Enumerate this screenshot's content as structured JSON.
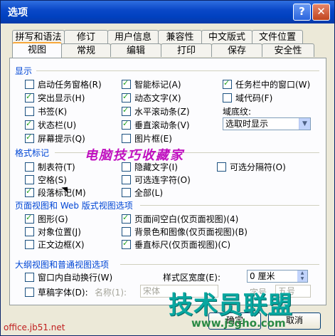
{
  "window": {
    "title": "选项",
    "help_glyph": "?",
    "close_glyph": "✕"
  },
  "tabs_back": [
    "拼写和语法",
    "修订",
    "用户信息",
    "兼容性",
    "中文版式",
    "文件位置"
  ],
  "tabs_front": [
    "视图",
    "常规",
    "编辑",
    "打印",
    "保存",
    "安全性"
  ],
  "display": {
    "title": "显示",
    "col1": [
      {
        "label": "启动任务窗格(R)",
        "checked": false
      },
      {
        "label": "突出显示(H)",
        "checked": true
      },
      {
        "label": "书签(K)",
        "checked": false
      },
      {
        "label": "状态栏(U)",
        "checked": true
      },
      {
        "label": "屏幕提示(Q)",
        "checked": true
      }
    ],
    "col2": [
      {
        "label": "智能标记(A)",
        "checked": true
      },
      {
        "label": "动态文字(X)",
        "checked": true
      },
      {
        "label": "水平滚动条(Z)",
        "checked": true
      },
      {
        "label": "垂直滚动条(V)",
        "checked": true
      },
      {
        "label": "图片框(E)",
        "checked": false
      }
    ],
    "col3": [
      {
        "label": "任务栏中的窗口(W)",
        "checked": true
      },
      {
        "label": "域代码(F)",
        "checked": false
      }
    ],
    "shading_label": "域底纹:",
    "shading_value": "选取时显示"
  },
  "format": {
    "title": "格式标记",
    "col1": [
      {
        "label": "制表符(T)",
        "checked": false
      },
      {
        "label": "空格(S)",
        "checked": false
      },
      {
        "label": "段落标记(M)",
        "checked": true
      }
    ],
    "col2": [
      {
        "label": "隐藏文字(I)",
        "checked": false
      },
      {
        "label": "可选连字符(O)",
        "checked": false
      },
      {
        "label": "全部(L)",
        "checked": false
      }
    ],
    "col3": [
      {
        "label": "可选分隔符(O)",
        "checked": false
      }
    ]
  },
  "page_web": {
    "title": "页面视图和 Web 版式视图选项",
    "col1": [
      {
        "label": "图形(G)",
        "checked": true
      },
      {
        "label": "对象位置(J)",
        "checked": false
      },
      {
        "label": "正文边框(X)",
        "checked": false
      }
    ],
    "col2": [
      {
        "label": "页面间空白(仅页面视图)(4)",
        "checked": true
      },
      {
        "label": "背景色和图像(仅页面视图)(B)",
        "checked": false
      },
      {
        "label": "垂直标尺(仅页面视图)(C)",
        "checked": true
      }
    ]
  },
  "outline": {
    "title": "大纲视图和普通视图选项",
    "wrap_label": "窗口内自动换行(W)",
    "draft_label": "草稿字体(D):",
    "name_label": "名称(1):",
    "name_value": "宋体",
    "size_label": "字号",
    "size_value": "五号",
    "style_width_label": "样式区宽度(E):",
    "style_width_value": "0 厘米"
  },
  "watermark_text": "电脑技巧收藏家",
  "logo": {
    "text": "技术员联盟",
    "url": "www.jsgho.com"
  },
  "footer_url": "office.jb51.net",
  "buttons": {
    "ok": "确定",
    "cancel": "取消"
  }
}
